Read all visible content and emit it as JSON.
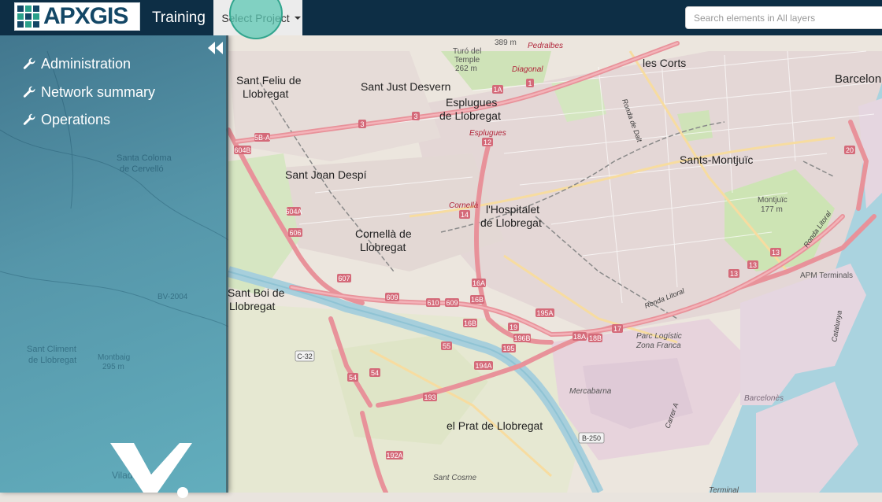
{
  "header": {
    "logo_text": "APXGIS",
    "project_title": "Training",
    "select_project_label": "Select Project",
    "search_placeholder": "Search elements in All layers"
  },
  "sidebar": {
    "items": [
      {
        "label": "Administration",
        "icon": "wrench-icon"
      },
      {
        "label": "Network summary",
        "icon": "wrench-icon"
      },
      {
        "label": "Operations",
        "icon": "wrench-icon"
      }
    ]
  },
  "map": {
    "places": {
      "sant_feliu": [
        "Sant Feliu de",
        "Llobregat"
      ],
      "sant_just": "Sant Just Desvern",
      "esplugues": [
        "Esplugues",
        "de Llobregat"
      ],
      "esplugues_small": "Esplugues",
      "les_corts": "les Corts",
      "barcelona": "Barcelon",
      "turo_temple": [
        "Turó del",
        "Temple",
        "262 m"
      ],
      "pedralbes": "Pedralbes",
      "diagonal": "Diagonal",
      "sant_joan_despi": "Sant Joan Despí",
      "hospitalet": [
        "l'Hospitalet",
        "de Llobregat"
      ],
      "cornella": [
        "Cornellà de",
        "Llobregat"
      ],
      "cornella_small": "Cornellà",
      "sants_montjuic": "Sants-Montjuïc",
      "montjuic": [
        "Montjuïc",
        "177 m"
      ],
      "apm": "APM Terminals",
      "sant_boi": [
        "Sant Boi de",
        "Llobregat"
      ],
      "ronda_litoral": "Ronda Litoral",
      "ronda_dalt": "Ronda de Dalt",
      "parc_logistic": [
        "Parc Logístic",
        "Zona Franca"
      ],
      "mercabarna": "Mercabarna",
      "el_prat": "el Prat de Llobregat",
      "sant_cosme": "Sant Cosme",
      "terminal": "Terminal",
      "barcelones": "Barcelonès",
      "catalunya": "Catalunya",
      "elevation_389": "389 m",
      "santa_coloma": [
        "Santa Coloma",
        "de Cervelló"
      ],
      "sant_climent": [
        "Sant Climent",
        "de Llobregat"
      ],
      "montbaig": [
        "Montbaig",
        "295 m"
      ],
      "viladecans": "Viladecans",
      "bv2004": "BV-2004",
      "carrer_a": "Carrer A",
      "b250": "B-250",
      "c32": "C-32"
    },
    "road_refs": [
      "5B-A",
      "604B",
      "604A",
      "606",
      "607",
      "607",
      "609",
      "610",
      "609",
      "16A",
      "16B",
      "16B",
      "19",
      "195A",
      "196B",
      "18A",
      "18B",
      "17",
      "13",
      "13",
      "55",
      "54",
      "54",
      "193",
      "192A",
      "194A",
      "195",
      "13",
      "20",
      "1",
      "1A",
      "3",
      "3",
      "12",
      "14"
    ]
  }
}
